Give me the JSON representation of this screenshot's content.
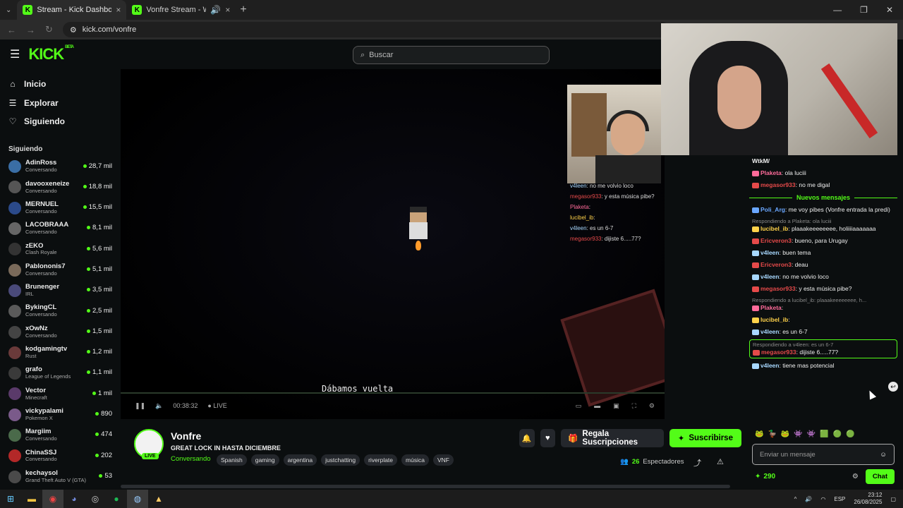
{
  "browser": {
    "tabs": [
      {
        "title": "Stream - Kick Dashboard",
        "active": true
      },
      {
        "title": "Vonfre Stream - Watch Live",
        "active": false
      }
    ],
    "url": "kick.com/vonfre"
  },
  "header": {
    "logo": "KICK",
    "logo_badge": "BETA",
    "search_placeholder": "Buscar"
  },
  "nav": {
    "items": [
      {
        "label": "Inicio",
        "icon": "home-icon"
      },
      {
        "label": "Explorar",
        "icon": "compass-icon"
      },
      {
        "label": "Siguiendo",
        "icon": "heart-icon"
      }
    ],
    "following_title": "Siguiendo"
  },
  "following": [
    {
      "name": "AdinRoss",
      "category": "Conversando",
      "viewers": "28,7 mil"
    },
    {
      "name": "davooxeneize",
      "category": "Conversando",
      "viewers": "18,8 mil"
    },
    {
      "name": "MERNUEL",
      "category": "Conversando",
      "viewers": "15,5 mil"
    },
    {
      "name": "LACOBRAAA",
      "category": "Conversando",
      "viewers": "8,1 mil"
    },
    {
      "name": "zEKO",
      "category": "Clash Royale",
      "viewers": "5,6 mil"
    },
    {
      "name": "Pablononis7",
      "category": "Conversando",
      "viewers": "5,1 mil"
    },
    {
      "name": "Brunenger",
      "category": "IRL",
      "viewers": "3,5 mil"
    },
    {
      "name": "BykingCL",
      "category": "Conversando",
      "viewers": "2,5 mil"
    },
    {
      "name": "xOwNz",
      "category": "Conversando",
      "viewers": "1,5 mil"
    },
    {
      "name": "kodgamingtv",
      "category": "Rust",
      "viewers": "1,2 mil"
    },
    {
      "name": "grafo",
      "category": "League of Legends",
      "viewers": "1,1 mil"
    },
    {
      "name": "Vector",
      "category": "Minecraft",
      "viewers": "1 mil"
    },
    {
      "name": "vickypalami",
      "category": "Pokemon X",
      "viewers": "890"
    },
    {
      "name": "Margiim",
      "category": "Conversando",
      "viewers": "474"
    },
    {
      "name": "ChinaSSJ",
      "category": "Conversando",
      "viewers": "202"
    },
    {
      "name": "kechaysol",
      "category": "Grand Theft Auto V (GTA)",
      "viewers": "53"
    }
  ],
  "player": {
    "subtitle": "Dábamos vuelta",
    "time": "00:38:32",
    "live_label": "LIVE",
    "overlay_chat": [
      {
        "user": "v4leen",
        "text": ": no me volvio loco",
        "color": "#a8d8ff"
      },
      {
        "user": "megasor933",
        "text": ": y esta música pibe?",
        "color": "#e64a4a"
      },
      {
        "user": "Plaketa",
        "text": ":",
        "color": "#ff6b9a"
      },
      {
        "user": "lucibel_ib",
        "text": ":",
        "color": "#ffd24a"
      },
      {
        "user": "v4leen",
        "text": ": es un 6-7",
        "color": "#a8d8ff"
      },
      {
        "user": "megasor933",
        "text": ": dijiste 6.....77?",
        "color": "#e64a4a"
      }
    ]
  },
  "stream": {
    "name": "Vonfre",
    "title": "GREAT LOCK IN HASTA DICIEMBRE",
    "category": "Conversando",
    "live_badge": "LIVE",
    "tags": [
      "Spanish",
      "gaming",
      "argentina",
      "justchatting",
      "riverplate",
      "música",
      "VNF"
    ],
    "gift_label": "Regala Suscripciones",
    "subscribe_label": "Suscribirse",
    "viewers_count": "26",
    "viewers_label": "Espectadores"
  },
  "chat": {
    "pinned_tail": "WtkM/",
    "new_messages_label": "Nuevos mensajes",
    "messages_before": [
      {
        "user": "Plaketa",
        "text": ": ola luciii",
        "color": "#ff6b9a"
      },
      {
        "user": "megasor933",
        "text": ": no me digal",
        "color": "#e64a4a"
      }
    ],
    "messages": [
      {
        "reply": "",
        "user": "Poli_Arg",
        "text": ": me voy pibes (Vonfre entrada la predi)",
        "color": "#6aa7ff"
      },
      {
        "reply": "Respondiendo a Plaketa: ola luciii",
        "user": "lucibel_ib",
        "text": ": plaaakeeeeeeee, holiiiiaaaaaaa",
        "color": "#ffd24a"
      },
      {
        "reply": "",
        "user": "Ericveron3",
        "text": ": bueno, para Urugay",
        "color": "#e64a4a"
      },
      {
        "reply": "",
        "user": "v4leen",
        "text": ": buen tema",
        "color": "#a8d8ff"
      },
      {
        "reply": "",
        "user": "Ericveron3",
        "text": ": deau",
        "color": "#e64a4a"
      },
      {
        "reply": "",
        "user": "v4leen",
        "text": ": no me volvio loco",
        "color": "#a8d8ff"
      },
      {
        "reply": "",
        "user": "megasor933",
        "text": ": y esta música pibe?",
        "color": "#e64a4a"
      },
      {
        "reply": "Respondiendo a lucibel_ib: plaaakeeeeeeee, h...",
        "user": "Plaketa",
        "text": ":",
        "color": "#ff6b9a"
      },
      {
        "reply": "",
        "user": "lucibel_ib",
        "text": ":",
        "color": "#ffd24a"
      },
      {
        "reply": "",
        "user": "v4leen",
        "text": ": es un 6-7",
        "color": "#a8d8ff"
      },
      {
        "reply": "Respondiendo a v4leen: es un 6-7",
        "user": "megasor933",
        "text": ": dijiste 6.....77?",
        "color": "#e64a4a",
        "highlight": true
      },
      {
        "reply": "",
        "user": "v4leen",
        "text": ": tiene mas potencial",
        "color": "#a8d8ff"
      }
    ],
    "input_placeholder": "Enviar un mensaje",
    "points": "290",
    "chat_button": "Chat"
  },
  "taskbar": {
    "lang": "ESP",
    "time": "23:12",
    "date": "26/08/2025"
  },
  "colors": {
    "accent": "#53fc18",
    "bg": "#0b0e0f"
  }
}
